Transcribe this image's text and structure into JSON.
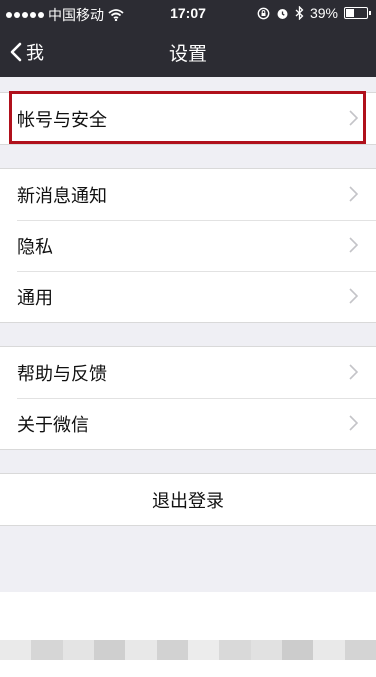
{
  "status_bar": {
    "carrier": "中国移动",
    "time": "17:07",
    "battery": "39%",
    "battery_level": 0.39
  },
  "nav": {
    "back_label": "我",
    "title": "设置"
  },
  "groups": [
    {
      "items": [
        {
          "label": "帐号与安全"
        }
      ]
    },
    {
      "items": [
        {
          "label": "新消息通知"
        },
        {
          "label": "隐私"
        },
        {
          "label": "通用"
        }
      ]
    },
    {
      "items": [
        {
          "label": "帮助与反馈"
        },
        {
          "label": "关于微信"
        }
      ]
    }
  ],
  "logout": {
    "label": "退出登录"
  },
  "icons": {
    "back": "chevron-left-icon",
    "row": "chevron-right-icon",
    "wifi": "wifi-icon",
    "lock": "rotation-lock-icon",
    "alarm": "alarm-icon",
    "bluetooth": "bluetooth-icon",
    "battery": "battery-icon"
  },
  "colors": {
    "bar_background": "#2c2c33",
    "page_background": "#efeff4",
    "highlight_border": "#b0101b"
  }
}
